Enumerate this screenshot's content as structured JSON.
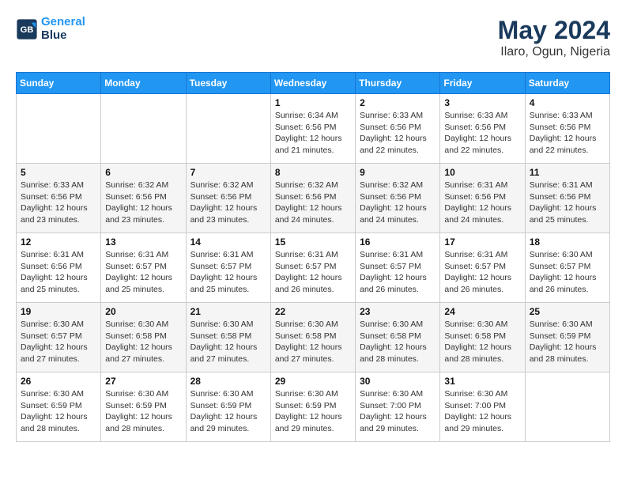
{
  "header": {
    "logo_line1": "General",
    "logo_line2": "Blue",
    "month_year": "May 2024",
    "location": "Ilaro, Ogun, Nigeria"
  },
  "weekdays": [
    "Sunday",
    "Monday",
    "Tuesday",
    "Wednesday",
    "Thursday",
    "Friday",
    "Saturday"
  ],
  "weeks": [
    [
      {
        "day": "",
        "info": ""
      },
      {
        "day": "",
        "info": ""
      },
      {
        "day": "",
        "info": ""
      },
      {
        "day": "1",
        "info": "Sunrise: 6:34 AM\nSunset: 6:56 PM\nDaylight: 12 hours\nand 21 minutes."
      },
      {
        "day": "2",
        "info": "Sunrise: 6:33 AM\nSunset: 6:56 PM\nDaylight: 12 hours\nand 22 minutes."
      },
      {
        "day": "3",
        "info": "Sunrise: 6:33 AM\nSunset: 6:56 PM\nDaylight: 12 hours\nand 22 minutes."
      },
      {
        "day": "4",
        "info": "Sunrise: 6:33 AM\nSunset: 6:56 PM\nDaylight: 12 hours\nand 22 minutes."
      }
    ],
    [
      {
        "day": "5",
        "info": "Sunrise: 6:33 AM\nSunset: 6:56 PM\nDaylight: 12 hours\nand 23 minutes."
      },
      {
        "day": "6",
        "info": "Sunrise: 6:32 AM\nSunset: 6:56 PM\nDaylight: 12 hours\nand 23 minutes."
      },
      {
        "day": "7",
        "info": "Sunrise: 6:32 AM\nSunset: 6:56 PM\nDaylight: 12 hours\nand 23 minutes."
      },
      {
        "day": "8",
        "info": "Sunrise: 6:32 AM\nSunset: 6:56 PM\nDaylight: 12 hours\nand 24 minutes."
      },
      {
        "day": "9",
        "info": "Sunrise: 6:32 AM\nSunset: 6:56 PM\nDaylight: 12 hours\nand 24 minutes."
      },
      {
        "day": "10",
        "info": "Sunrise: 6:31 AM\nSunset: 6:56 PM\nDaylight: 12 hours\nand 24 minutes."
      },
      {
        "day": "11",
        "info": "Sunrise: 6:31 AM\nSunset: 6:56 PM\nDaylight: 12 hours\nand 25 minutes."
      }
    ],
    [
      {
        "day": "12",
        "info": "Sunrise: 6:31 AM\nSunset: 6:56 PM\nDaylight: 12 hours\nand 25 minutes."
      },
      {
        "day": "13",
        "info": "Sunrise: 6:31 AM\nSunset: 6:57 PM\nDaylight: 12 hours\nand 25 minutes."
      },
      {
        "day": "14",
        "info": "Sunrise: 6:31 AM\nSunset: 6:57 PM\nDaylight: 12 hours\nand 25 minutes."
      },
      {
        "day": "15",
        "info": "Sunrise: 6:31 AM\nSunset: 6:57 PM\nDaylight: 12 hours\nand 26 minutes."
      },
      {
        "day": "16",
        "info": "Sunrise: 6:31 AM\nSunset: 6:57 PM\nDaylight: 12 hours\nand 26 minutes."
      },
      {
        "day": "17",
        "info": "Sunrise: 6:31 AM\nSunset: 6:57 PM\nDaylight: 12 hours\nand 26 minutes."
      },
      {
        "day": "18",
        "info": "Sunrise: 6:30 AM\nSunset: 6:57 PM\nDaylight: 12 hours\nand 26 minutes."
      }
    ],
    [
      {
        "day": "19",
        "info": "Sunrise: 6:30 AM\nSunset: 6:57 PM\nDaylight: 12 hours\nand 27 minutes."
      },
      {
        "day": "20",
        "info": "Sunrise: 6:30 AM\nSunset: 6:58 PM\nDaylight: 12 hours\nand 27 minutes."
      },
      {
        "day": "21",
        "info": "Sunrise: 6:30 AM\nSunset: 6:58 PM\nDaylight: 12 hours\nand 27 minutes."
      },
      {
        "day": "22",
        "info": "Sunrise: 6:30 AM\nSunset: 6:58 PM\nDaylight: 12 hours\nand 27 minutes."
      },
      {
        "day": "23",
        "info": "Sunrise: 6:30 AM\nSunset: 6:58 PM\nDaylight: 12 hours\nand 28 minutes."
      },
      {
        "day": "24",
        "info": "Sunrise: 6:30 AM\nSunset: 6:58 PM\nDaylight: 12 hours\nand 28 minutes."
      },
      {
        "day": "25",
        "info": "Sunrise: 6:30 AM\nSunset: 6:59 PM\nDaylight: 12 hours\nand 28 minutes."
      }
    ],
    [
      {
        "day": "26",
        "info": "Sunrise: 6:30 AM\nSunset: 6:59 PM\nDaylight: 12 hours\nand 28 minutes."
      },
      {
        "day": "27",
        "info": "Sunrise: 6:30 AM\nSunset: 6:59 PM\nDaylight: 12 hours\nand 28 minutes."
      },
      {
        "day": "28",
        "info": "Sunrise: 6:30 AM\nSunset: 6:59 PM\nDaylight: 12 hours\nand 29 minutes."
      },
      {
        "day": "29",
        "info": "Sunrise: 6:30 AM\nSunset: 6:59 PM\nDaylight: 12 hours\nand 29 minutes."
      },
      {
        "day": "30",
        "info": "Sunrise: 6:30 AM\nSunset: 7:00 PM\nDaylight: 12 hours\nand 29 minutes."
      },
      {
        "day": "31",
        "info": "Sunrise: 6:30 AM\nSunset: 7:00 PM\nDaylight: 12 hours\nand 29 minutes."
      },
      {
        "day": "",
        "info": ""
      }
    ]
  ]
}
